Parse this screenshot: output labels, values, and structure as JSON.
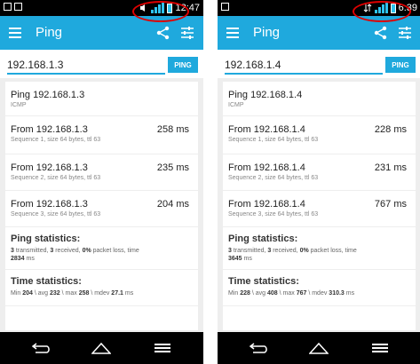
{
  "colors": {
    "accent": "#1fa9dd",
    "background": "#eeeeee",
    "annotation": "#e00000"
  },
  "screens": [
    {
      "status_time": "12:47",
      "app_title": "Ping",
      "ip_value": "192.168.1.3",
      "ping_button": "PING",
      "header": {
        "title": "Ping 192.168.1.3",
        "sub": "ICMP"
      },
      "replies": [
        {
          "from": "From 192.168.1.3",
          "detail": "Sequence 1, size 64 bytes, ttl 63",
          "time": "258 ms"
        },
        {
          "from": "From 192.168.1.3",
          "detail": "Sequence 2, size 64 bytes, ttl 63",
          "time": "235 ms"
        },
        {
          "from": "From 192.168.1.3",
          "detail": "Sequence 3, size 64 bytes, ttl 63",
          "time": "204 ms"
        }
      ],
      "ping_stats": {
        "title": "Ping statistics:",
        "transmitted": "3",
        "transmitted_label": " transmitted, ",
        "received": "3",
        "received_label": " received, ",
        "loss": "0%",
        "loss_label": " packet loss, time ",
        "time": "2834",
        "time_unit": " ms"
      },
      "time_stats": {
        "title": "Time statistics:",
        "min_label": "Min ",
        "min": "204",
        "avg_label": " \\ avg ",
        "avg": "232",
        "max_label": " \\ max ",
        "max": "258",
        "mdev_label": " \\ mdev ",
        "mdev": "27.1",
        "unit": " ms"
      }
    },
    {
      "status_time": "6:39",
      "app_title": "Ping",
      "ip_value": "192.168.1.4",
      "ping_button": "PING",
      "header": {
        "title": "Ping 192.168.1.4",
        "sub": "ICMP"
      },
      "replies": [
        {
          "from": "From 192.168.1.4",
          "detail": "Sequence 1, size 64 bytes, ttl 63",
          "time": "228 ms"
        },
        {
          "from": "From 192.168.1.4",
          "detail": "Sequence 2, size 64 bytes, ttl 63",
          "time": "231 ms"
        },
        {
          "from": "From 192.168.1.4",
          "detail": "Sequence 3, size 64 bytes, ttl 63",
          "time": "767 ms"
        }
      ],
      "ping_stats": {
        "title": "Ping statistics:",
        "transmitted": "3",
        "transmitted_label": " transmitted, ",
        "received": "3",
        "received_label": " received, ",
        "loss": "0%",
        "loss_label": " packet loss, time ",
        "time": "3645",
        "time_unit": " ms"
      },
      "time_stats": {
        "title": "Time statistics:",
        "min_label": "Min ",
        "min": "228",
        "avg_label": " \\ avg ",
        "avg": "408",
        "max_label": " \\ max ",
        "max": "767",
        "mdev_label": " \\ mdev ",
        "mdev": "310.3",
        "unit": " ms"
      }
    }
  ]
}
